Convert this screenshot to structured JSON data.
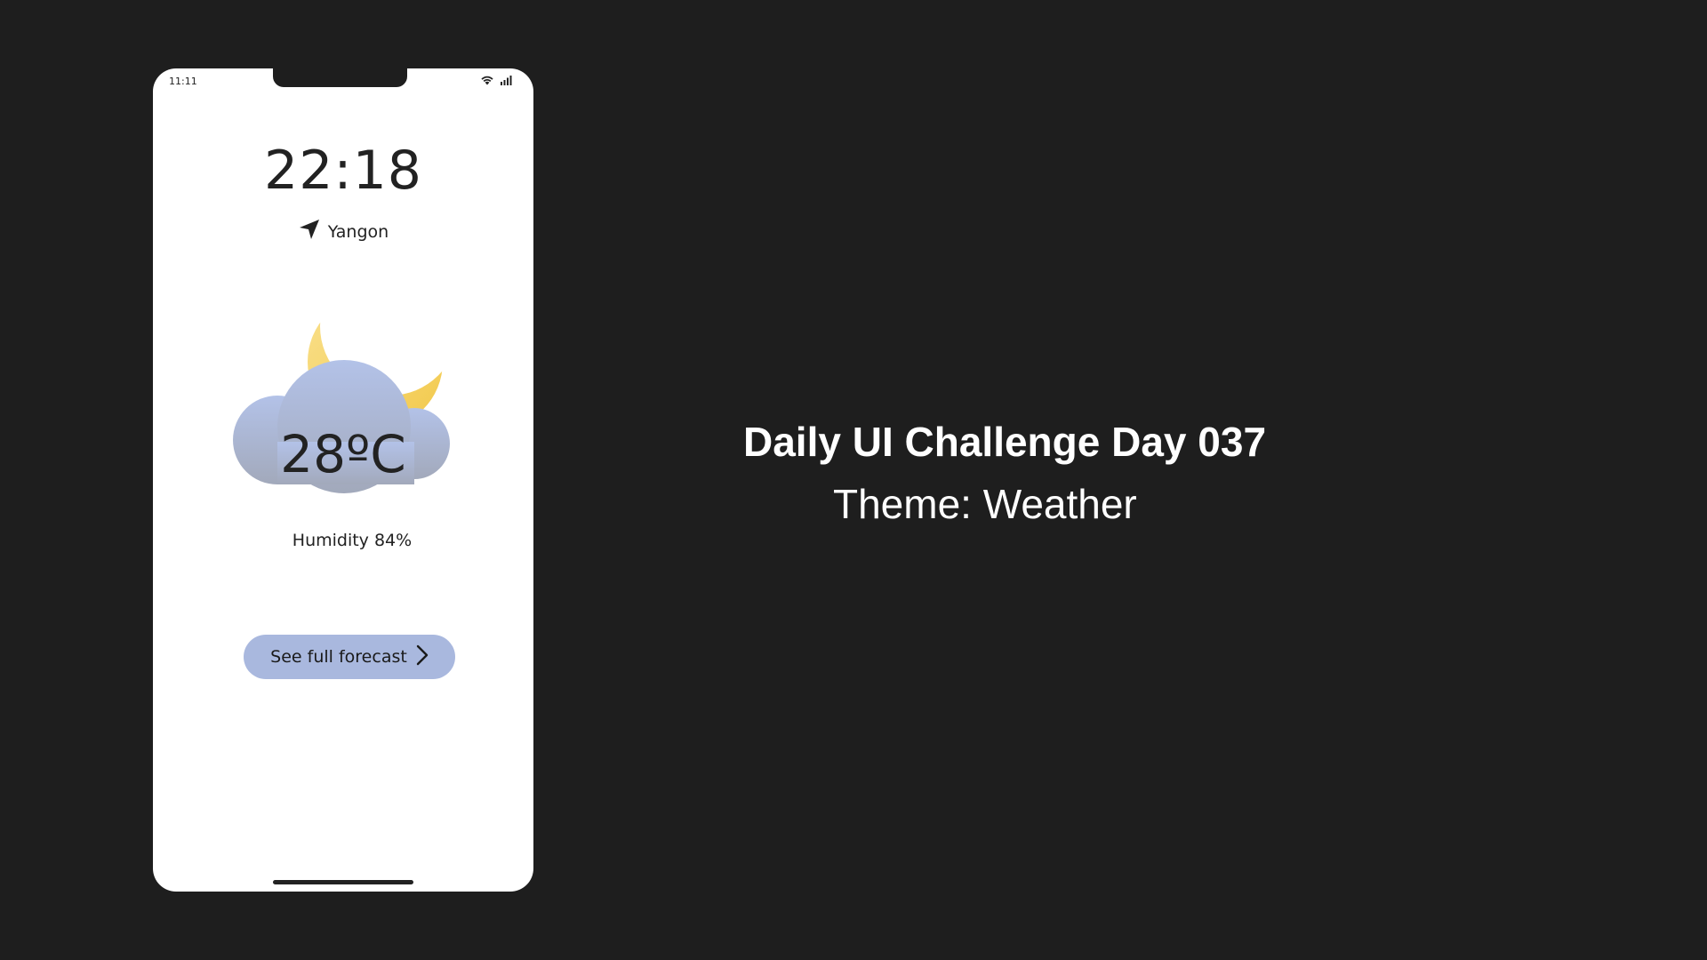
{
  "status_bar": {
    "time": "11:11",
    "icons": [
      "wifi-icon",
      "signal-icon"
    ]
  },
  "weather": {
    "clock": "22:18",
    "location": "Yangon",
    "temperature": "28ºC",
    "humidity": "Humidity 84%",
    "condition_icons": [
      "moon-icon",
      "cloud-icon"
    ]
  },
  "forecast_button": {
    "label": "See full forecast",
    "icon": "chevron-right-icon"
  },
  "headline": {
    "title": "Daily UI Challenge Day 037",
    "subtitle": "Theme: Weather"
  },
  "colors": {
    "background": "#1e1e1e",
    "phone": "#ffffff",
    "button": "#a9b8de",
    "moon": "#f5d675",
    "cloud": "#a9b8de"
  }
}
